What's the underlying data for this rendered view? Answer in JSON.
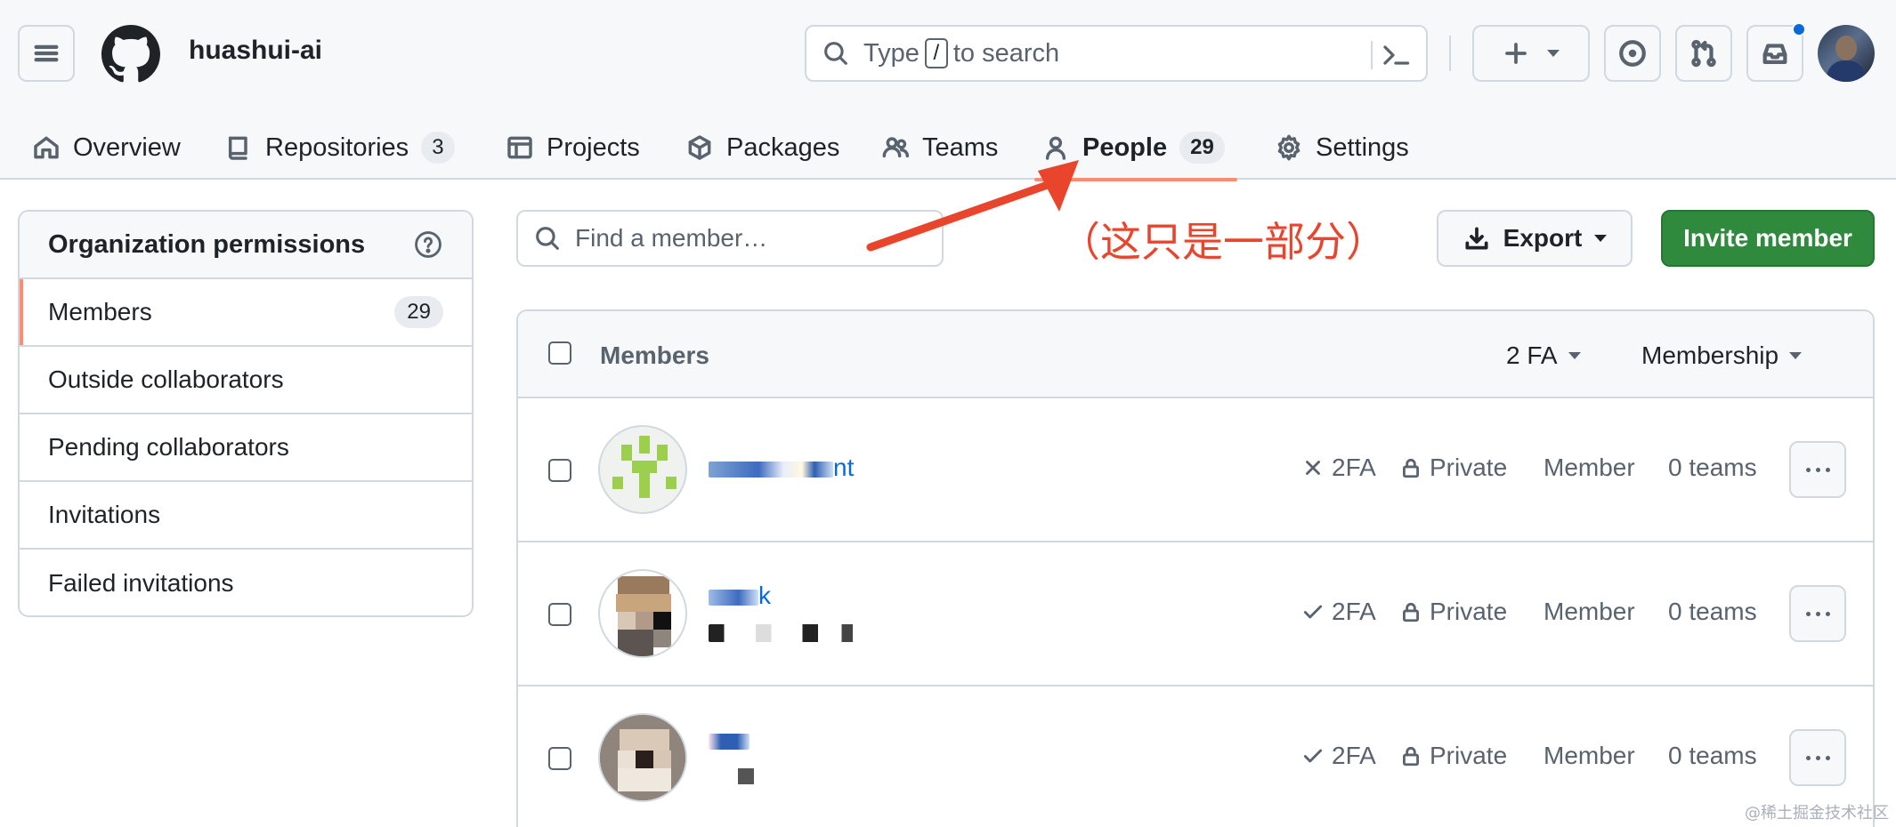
{
  "header": {
    "org_name": "huashui-ai",
    "search": {
      "before": "Type",
      "key": "/",
      "after": "to search"
    }
  },
  "tabs": [
    {
      "label": "Overview",
      "icon": "home-icon"
    },
    {
      "label": "Repositories",
      "count": "3",
      "icon": "repo-icon"
    },
    {
      "label": "Projects",
      "icon": "table-icon"
    },
    {
      "label": "Packages",
      "icon": "package-icon"
    },
    {
      "label": "Teams",
      "icon": "people-icon"
    },
    {
      "label": "People",
      "count": "29",
      "icon": "person-icon",
      "active": true
    },
    {
      "label": "Settings",
      "icon": "gear-icon"
    }
  ],
  "sidebar": {
    "title": "Organization permissions",
    "items": [
      {
        "label": "Members",
        "count": "29",
        "active": true
      },
      {
        "label": "Outside collaborators"
      },
      {
        "label": "Pending collaborators"
      },
      {
        "label": "Invitations"
      },
      {
        "label": "Failed invitations"
      }
    ]
  },
  "main": {
    "find_placeholder": "Find a member…",
    "annotation": "（这只是一部分）",
    "export_label": "Export",
    "invite_label": "Invite member",
    "table": {
      "header_label": "Members",
      "filter_2fa": "2 FA",
      "filter_membership": "Membership"
    },
    "members": [
      {
        "name_tail": "nt",
        "twofa": "2FA",
        "twofa_state": "disabled",
        "visibility": "Private",
        "role": "Member",
        "teams": "0 teams"
      },
      {
        "name_tail": "k",
        "twofa": "2FA",
        "twofa_state": "enabled",
        "visibility": "Private",
        "role": "Member",
        "teams": "0 teams"
      },
      {
        "name_tail": "",
        "twofa": "2FA",
        "twofa_state": "enabled",
        "visibility": "Private",
        "role": "Member",
        "teams": "0 teams"
      }
    ]
  },
  "watermark": "@稀土掘金技术社区",
  "colors": {
    "accent_underline": "#fd8c73",
    "primary_button": "#2f8a3e",
    "link": "#0969da",
    "annotation": "#e8452c"
  }
}
